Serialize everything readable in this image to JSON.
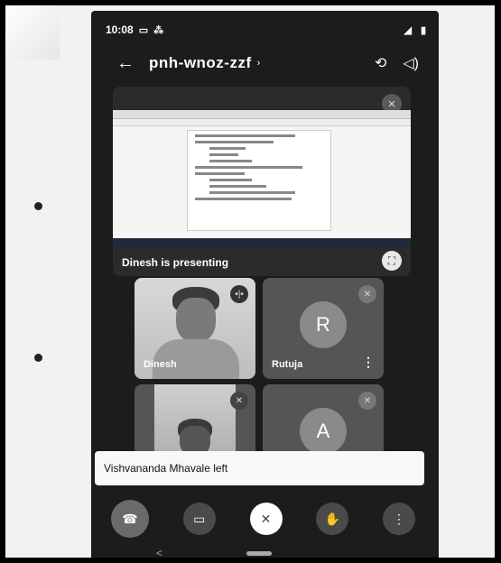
{
  "status": {
    "time": "10:08",
    "left_icons": [
      "screen-record-icon",
      "alarm-icon"
    ],
    "right_icons": [
      "signal-icon",
      "battery-icon"
    ]
  },
  "header": {
    "meeting_code": "pnh-wnoz-zzf",
    "chevron": "›",
    "actions": [
      "switch-camera-icon",
      "speaker-icon"
    ]
  },
  "presentation": {
    "label": "Dinesh is presenting"
  },
  "participants": [
    {
      "name": "Dinesh",
      "avatar_letter": "",
      "muted": false
    },
    {
      "name": "Rutuja",
      "avatar_letter": "R",
      "muted": true
    },
    {
      "name": "",
      "avatar_letter": "",
      "muted": true
    },
    {
      "name": "",
      "avatar_letter": "A",
      "muted": true
    }
  ],
  "toast": {
    "message": "Vishvananda Mhavale left"
  },
  "controls": {
    "end_call": "end-call-icon",
    "camera": "video-camera-icon",
    "microphone": "microphone-off-icon",
    "hand": "raise-hand-icon",
    "more": "more-options-icon"
  },
  "navigation": {
    "back_glyph": "<"
  },
  "colors": {
    "phone_bg": "#1c1c1c",
    "tile_bg": "#555555",
    "toast_bg": "#f8f8f8",
    "mic_button_bg": "#ffffff"
  }
}
